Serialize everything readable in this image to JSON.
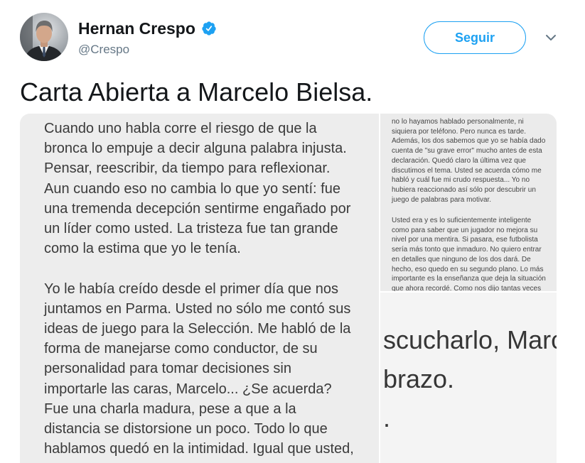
{
  "tweet": {
    "author": {
      "name": "Hernan Crespo",
      "handle": "@Crespo",
      "verified": true,
      "verified_icon": "verified-badge-icon",
      "avatar_icon": "avatar-photo"
    },
    "follow_button": {
      "label": "Seguir"
    },
    "menu_icon": "chevron-down-icon",
    "text": "Carta Abierta a Marcelo Bielsa.",
    "colors": {
      "accent": "#1da1f2",
      "primary_text": "#14171a",
      "secondary_text": "#657786"
    },
    "media": [
      {
        "paragraphs": [
          [
            "Cuando uno habla corre el riesgo de que la",
            "bronca lo empuje a decir alguna palabra injusta.",
            "Pensar, reescribir, da tiempo para reflexionar.",
            "Aun cuando eso no cambia lo que yo sentí: fue",
            "una tremenda decepción sentirme engañado por",
            "un líder como usted. La tristeza fue tan grande",
            "como la estima que yo le tenía."
          ],
          [
            "Yo le había creído desde el primer día que nos",
            "juntamos en Parma. Usted no sólo me contó sus",
            "ideas de juego para la Selección. Me habló de la",
            "forma de manejarse como conductor, de su",
            "personalidad para tomar decisiones sin",
            "importarle las caras, Marcelo... ¿Se acuerda?",
            "Fue una charla madura, pese a que a la",
            "distancia se distorsione un poco. Todo lo que",
            "hablamos quedó en la intimidad. Igual que usted,"
          ]
        ]
      },
      {
        "paragraphs": [
          [
            "no lo hayamos hablado personalmente, ni",
            "siquiera por teléfono. Pero nunca es tarde.",
            "Además, los dos sabemos que yo se había dado",
            "cuenta de \"su grave error\" mucho antes de esta",
            "declaración. Quedó claro la última vez que",
            "discutimos el tema. Usted se acuerda cómo me",
            "habló y cuál fue mi crudo respuesta... Yo no",
            "hubiera reaccionado así sólo por descubrir un",
            "juego de palabras para motivar."
          ],
          [
            "Usted era y es lo suficientemente inteligente",
            "como para saber que un jugador no mejora su",
            "nivel por una mentira. Si pasara, ese futbolista",
            "sería más tonto que inmaduro. No quiero entrar",
            "en detalles que ninguno de los dos dará. De",
            "hecho, eso quedo en su segundo plano. Lo más",
            "importante es la enseñanza que deja la situación",
            "que ahora recordé. Como nos dijo tantas veces"
          ]
        ]
      },
      {
        "lines": [
          "scucharlo, Marc",
          "brazo.",
          "."
        ]
      }
    ]
  }
}
